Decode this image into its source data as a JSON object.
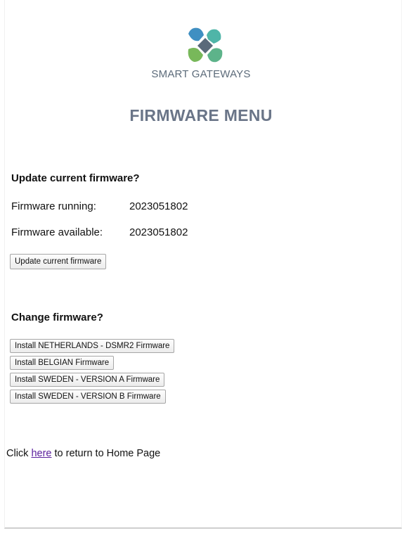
{
  "brand": {
    "name": "SMART GATEWAYS",
    "colors": {
      "blue": "#3f8fc2",
      "teal": "#4fb5a8",
      "green": "#78b85a",
      "dark": "#5a6a7a"
    }
  },
  "page": {
    "title": "FIRMWARE MENU"
  },
  "update_section": {
    "heading": "Update current firmware?",
    "running_label": "Firmware running:",
    "running_value": "2023051802",
    "available_label": "Firmware available:",
    "available_value": "2023051802",
    "update_button": "Update current firmware"
  },
  "change_section": {
    "heading": "Change firmware?",
    "buttons": [
      "Install NETHERLANDS - DSMR2 Firmware",
      "Install BELGIAN Firmware",
      "Install SWEDEN - VERSION A Firmware",
      "Install SWEDEN - VERSION B Firmware"
    ]
  },
  "footer": {
    "prefix": "Click",
    "link_text": "here",
    "suffix": "to return to Home Page"
  }
}
